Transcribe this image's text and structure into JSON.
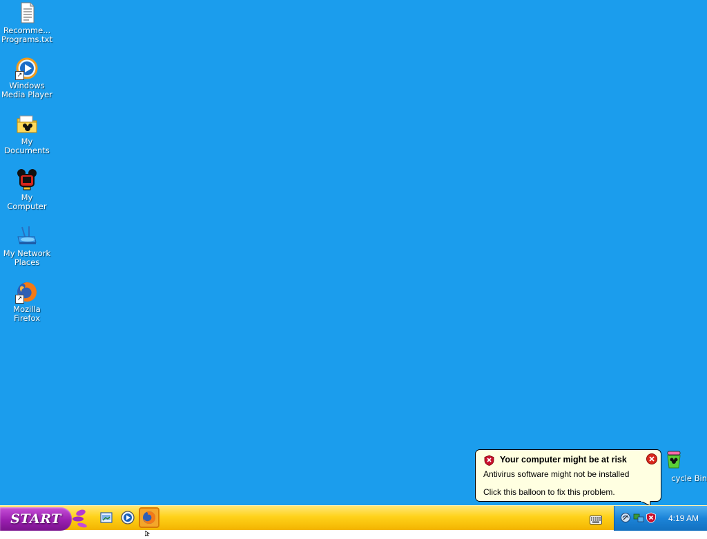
{
  "desktop": {
    "background_color": "#1b9ded",
    "icons": [
      {
        "label": "Recomme...\nPrograms.txt",
        "icon": "text-file-icon"
      },
      {
        "label": "Windows\nMedia Player",
        "icon": "media-player-icon"
      },
      {
        "label": "My\nDocuments",
        "icon": "my-documents-folder-icon"
      },
      {
        "label": "My\nComputer",
        "icon": "my-computer-icon"
      },
      {
        "label": "My Network\nPlaces",
        "icon": "network-places-icon"
      },
      {
        "label": "Mozilla\nFirefox",
        "icon": "firefox-icon"
      }
    ],
    "recycle_bin": {
      "label": "cycle Bin",
      "icon": "recycle-bin-icon"
    }
  },
  "taskbar": {
    "start_label": "START",
    "quick_launch": [
      {
        "name": "show-desktop",
        "icon": "show-desktop-icon"
      },
      {
        "name": "media-player",
        "icon": "media-player-icon"
      },
      {
        "name": "firefox",
        "icon": "firefox-icon"
      }
    ],
    "clock": "4:19 AM",
    "colors": {
      "taskbar": "#ffd21a",
      "start": "#9a1fb0",
      "tray": "#1c84d8"
    }
  },
  "balloon": {
    "title": "Your computer might be at risk",
    "line1": "Antivirus software might not be installed",
    "line2": "Click this balloon to fix this problem."
  }
}
